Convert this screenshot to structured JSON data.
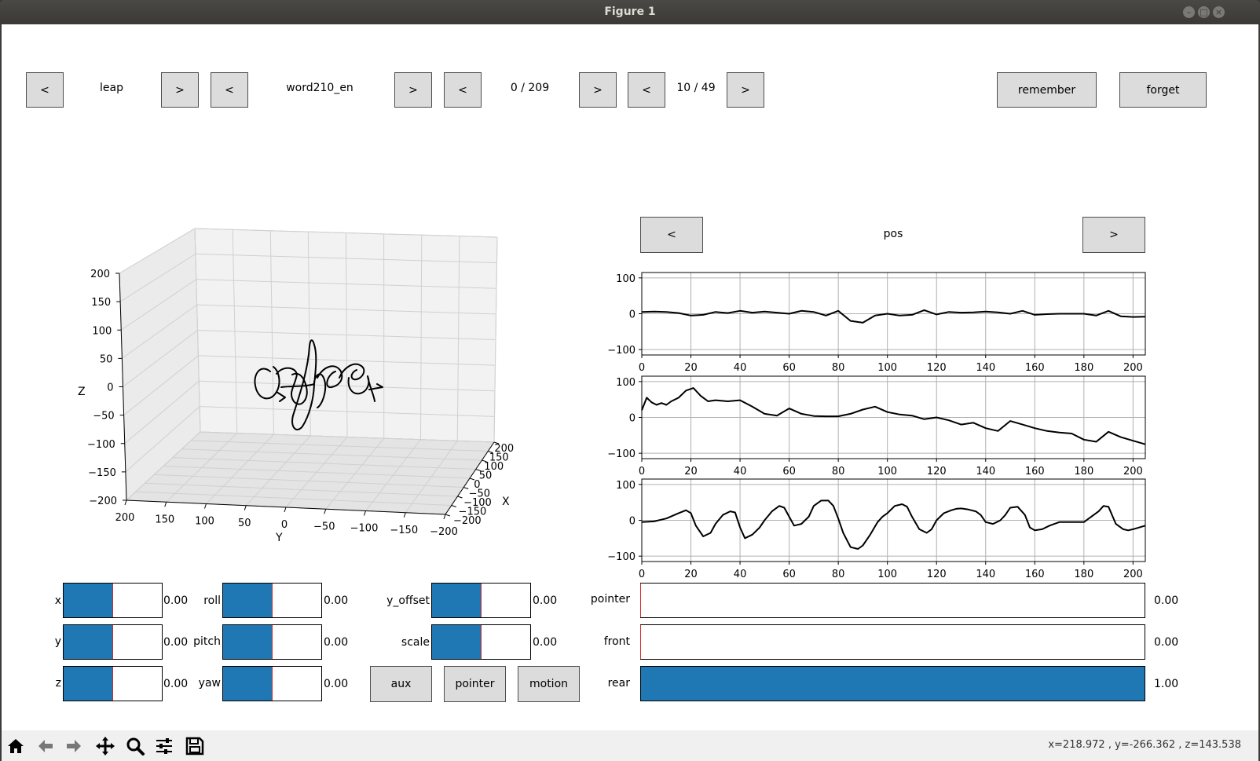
{
  "window": {
    "title": "Figure 1"
  },
  "nav": {
    "prev": "<",
    "next": ">",
    "device": "leap",
    "word": "word210_en",
    "word_index": "0 / 209",
    "sample_index": "10 / 49",
    "remember": "remember",
    "forget": "forget"
  },
  "plot3d": {
    "z_label": "Z",
    "y_label": "Y",
    "x_label": "X",
    "z_ticks": [
      "200",
      "150",
      "100",
      "50",
      "0",
      "−50",
      "−100",
      "−150",
      "−200"
    ],
    "y_ticks": [
      "200",
      "150",
      "100",
      "50",
      "0",
      "−50",
      "−100",
      "−150",
      "−200"
    ],
    "x_ticks": [
      "200",
      "150",
      "100",
      "50",
      "0",
      "−50",
      "−100",
      "−150",
      "−200"
    ]
  },
  "signal_panel": {
    "prev": "<",
    "next": ">",
    "mode": "pos"
  },
  "chart_data": [
    {
      "type": "line",
      "x": [
        0,
        5,
        10,
        15,
        20,
        25,
        30,
        35,
        40,
        45,
        50,
        55,
        60,
        65,
        70,
        75,
        80,
        85,
        90,
        95,
        100,
        105,
        110,
        115,
        120,
        125,
        130,
        135,
        140,
        145,
        150,
        155,
        160,
        165,
        170,
        175,
        180,
        185,
        190,
        195,
        200,
        205
      ],
      "series": [
        {
          "values": [
            5,
            6,
            5,
            2,
            -5,
            -3,
            5,
            2,
            8,
            3,
            6,
            3,
            0,
            8,
            5,
            -5,
            8,
            -20,
            -25,
            -5,
            0,
            -5,
            -3,
            10,
            -2,
            5,
            3,
            4,
            6,
            4,
            0,
            8,
            -3,
            -1,
            0,
            0,
            0,
            -5,
            8,
            -7,
            -9,
            -8
          ]
        }
      ],
      "xlim": [
        0,
        205
      ],
      "ylim": [
        -115,
        115
      ],
      "xticks": [
        "0",
        "20",
        "40",
        "60",
        "80",
        "100",
        "120",
        "140",
        "160",
        "180",
        "200"
      ],
      "yticks": [
        "100",
        "0",
        "−100"
      ],
      "grid": true
    },
    {
      "type": "line",
      "x": [
        0,
        2,
        4,
        6,
        8,
        10,
        12,
        15,
        18,
        21,
        24,
        27,
        30,
        35,
        40,
        45,
        50,
        55,
        60,
        65,
        70,
        75,
        80,
        85,
        90,
        95,
        100,
        105,
        110,
        115,
        120,
        125,
        130,
        135,
        140,
        145,
        150,
        155,
        160,
        165,
        170,
        175,
        180,
        185,
        190,
        195,
        200,
        205
      ],
      "series": [
        {
          "values": [
            20,
            55,
            42,
            35,
            40,
            35,
            45,
            55,
            75,
            82,
            60,
            45,
            48,
            45,
            48,
            30,
            10,
            5,
            25,
            10,
            4,
            3,
            3,
            10,
            22,
            30,
            15,
            8,
            5,
            -5,
            0,
            -8,
            -20,
            -15,
            -30,
            -38,
            -10,
            -20,
            -30,
            -38,
            -42,
            -45,
            -62,
            -68,
            -40,
            -55,
            -65,
            -75
          ]
        }
      ],
      "xlim": [
        0,
        205
      ],
      "ylim": [
        -115,
        115
      ],
      "xticks": [
        "0",
        "20",
        "40",
        "60",
        "80",
        "100",
        "120",
        "140",
        "160",
        "180",
        "200"
      ],
      "yticks": [
        "100",
        "0",
        "−100"
      ],
      "grid": true
    },
    {
      "type": "line",
      "x": [
        0,
        5,
        10,
        15,
        18,
        20,
        22,
        25,
        28,
        30,
        33,
        36,
        38,
        40,
        42,
        45,
        48,
        50,
        53,
        56,
        58,
        60,
        62,
        65,
        68,
        70,
        73,
        76,
        78,
        80,
        82,
        85,
        88,
        90,
        93,
        96,
        98,
        100,
        103,
        106,
        108,
        110,
        113,
        116,
        118,
        120,
        123,
        126,
        128,
        130,
        133,
        136,
        138,
        140,
        143,
        146,
        148,
        150,
        153,
        156,
        158,
        160,
        163,
        166,
        168,
        170,
        173,
        176,
        178,
        180,
        183,
        186,
        188,
        190,
        193,
        196,
        198,
        200,
        205
      ],
      "series": [
        {
          "values": [
            -5,
            -3,
            5,
            20,
            28,
            20,
            -15,
            -45,
            -35,
            -10,
            15,
            25,
            22,
            -20,
            -50,
            -40,
            -20,
            0,
            25,
            40,
            35,
            10,
            -15,
            -10,
            10,
            40,
            55,
            55,
            40,
            5,
            -35,
            -75,
            -80,
            -70,
            -40,
            -5,
            10,
            20,
            40,
            45,
            38,
            10,
            -25,
            -35,
            -25,
            0,
            20,
            28,
            32,
            33,
            30,
            25,
            15,
            -5,
            -10,
            0,
            15,
            35,
            38,
            15,
            -20,
            -28,
            -25,
            -15,
            -10,
            -5,
            -5,
            -5,
            -5,
            -5,
            10,
            25,
            40,
            38,
            -10,
            -25,
            -28,
            -25,
            -15
          ]
        }
      ],
      "xlim": [
        0,
        205
      ],
      "ylim": [
        -115,
        115
      ],
      "xticks": [
        "0",
        "20",
        "40",
        "60",
        "80",
        "100",
        "120",
        "140",
        "160",
        "180",
        "200"
      ],
      "yticks": [
        "100",
        "0",
        "−100"
      ],
      "grid": true
    }
  ],
  "sliders": {
    "x": {
      "label": "x",
      "value": 0.5,
      "text": "0.00"
    },
    "y": {
      "label": "y",
      "value": 0.5,
      "text": "0.00"
    },
    "z": {
      "label": "z",
      "value": 0.5,
      "text": "0.00"
    },
    "roll": {
      "label": "roll",
      "value": 0.5,
      "text": "0.00"
    },
    "pitch": {
      "label": "pitch",
      "value": 0.5,
      "text": "0.00"
    },
    "yaw": {
      "label": "yaw",
      "value": 0.5,
      "text": "0.00"
    },
    "y_offset": {
      "label": "y_offset",
      "value": 0.5,
      "text": "0.00"
    },
    "scale": {
      "label": "scale",
      "value": 0.5,
      "text": "0.00"
    },
    "pointer": {
      "label": "pointer",
      "value": 0.0,
      "text": "0.00"
    },
    "front": {
      "label": "front",
      "value": 0.0,
      "text": "0.00"
    },
    "rear": {
      "label": "rear",
      "value": 1.0,
      "text": "1.00"
    }
  },
  "mode_buttons": {
    "aux": "aux",
    "pointer": "pointer",
    "motion": "motion"
  },
  "toolbar": {
    "icons": [
      "home-icon",
      "back-icon",
      "forward-icon",
      "pan-icon",
      "zoom-icon",
      "configure-icon",
      "save-icon"
    ],
    "coords": "x=218.972     , y=-266.362     , z=143.538"
  },
  "colors": {
    "accent": "#1f77b4",
    "slider_line": "#d62728",
    "button": "#dcdcdc"
  }
}
